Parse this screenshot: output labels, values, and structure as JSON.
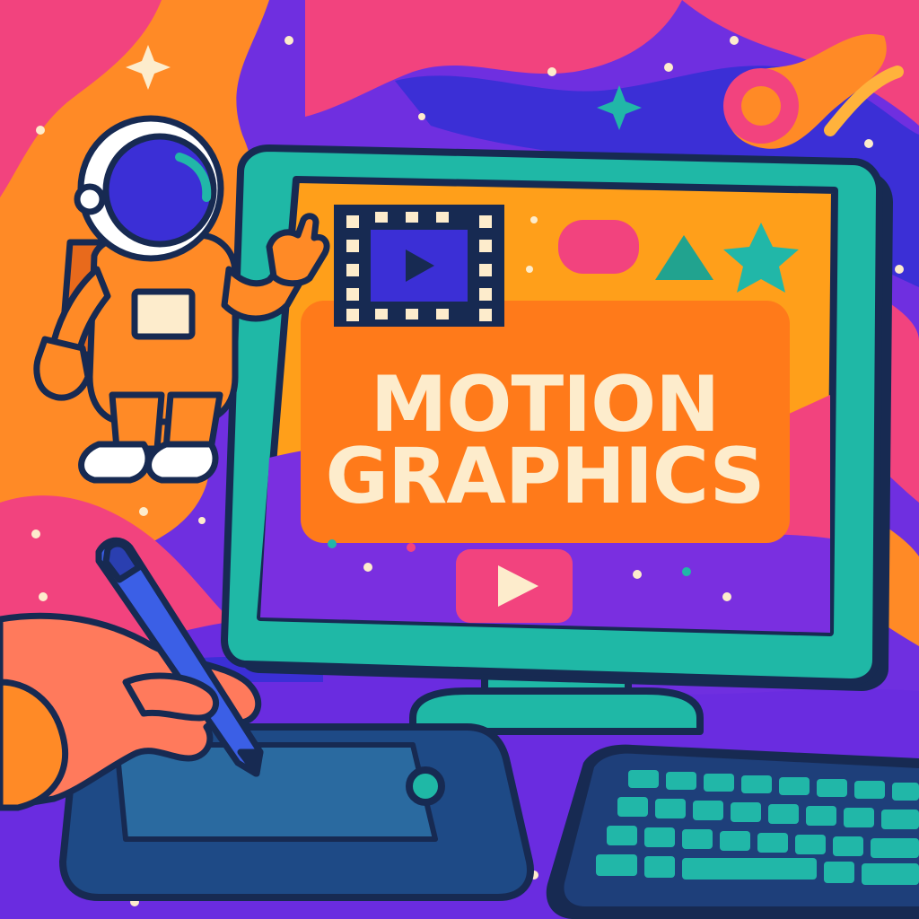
{
  "screen": {
    "title_line1": "MOTION",
    "title_line2": "GRAPHICS"
  },
  "colors": {
    "background": "#6f2fe0",
    "blob_orange": "#ff8a26",
    "blob_pink": "#f2437e",
    "blob_blue": "#3b2fd6",
    "monitor_frame": "#1fb8a6",
    "outline": "#172a52",
    "title_text": "#fdeccc",
    "accent_teal": "#21b7a8",
    "accent_pink": "#f2437e"
  },
  "icons": [
    "film-strip-icon",
    "play-icon",
    "triangle-icon",
    "star-icon",
    "comet-icon",
    "sparkle-icon"
  ]
}
